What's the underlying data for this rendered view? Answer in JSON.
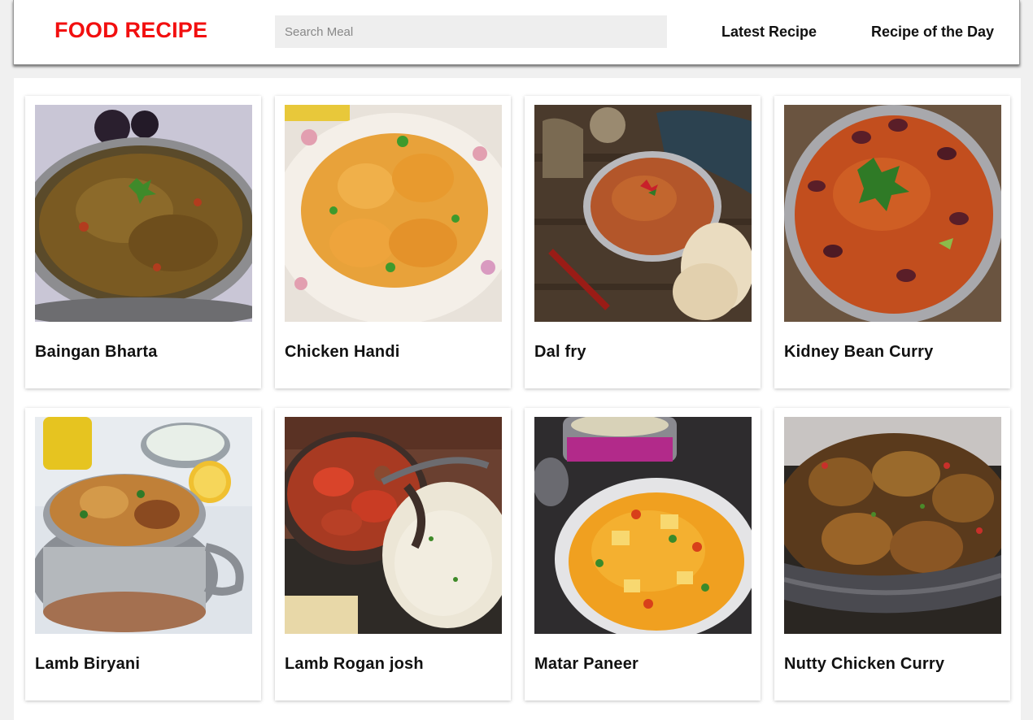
{
  "header": {
    "logo": "FOOD RECIPE",
    "search_placeholder": "Search Meal",
    "nav": [
      "Latest Recipe",
      "Recipe of the Day"
    ]
  },
  "meals": [
    {
      "name": "Baingan Bharta"
    },
    {
      "name": "Chicken Handi"
    },
    {
      "name": "Dal fry"
    },
    {
      "name": "Kidney Bean Curry"
    },
    {
      "name": "Lamb Biryani"
    },
    {
      "name": "Lamb Rogan josh"
    },
    {
      "name": "Matar Paneer"
    },
    {
      "name": "Nutty Chicken Curry"
    }
  ],
  "colors": {
    "logo": "#f20f0f",
    "search_bg": "#eeeeee",
    "page_bg": "#f0f0f0"
  }
}
